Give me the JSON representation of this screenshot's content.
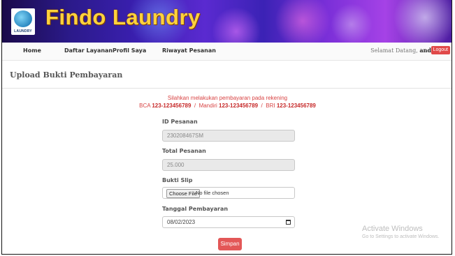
{
  "header": {
    "brand": "Findo Laundry",
    "logo_text": "LAUNDRY"
  },
  "nav": {
    "items": [
      "Home",
      "Daftar Layanan",
      "Profil Saya",
      "Riwayat Pesanan"
    ],
    "welcome_prefix": "Selamat Datang,",
    "username": "andi",
    "logout_label": "Logout"
  },
  "page": {
    "title": "Upload Bukti Pembayaran"
  },
  "instructions": {
    "line1": "Silahkan melakukan pembayaran pada rekening",
    "bca_label": "BCA",
    "bca_no": "123-123456789",
    "mandiri_label": "Mandiri",
    "mandiri_no": "123-123456789",
    "bri_label": "BRI",
    "bri_no": "123-123456789",
    "separator": "/"
  },
  "form": {
    "id_label": "ID Pesanan",
    "id_value": "230208467SM",
    "total_label": "Total Pesanan",
    "total_value": "25.000",
    "slip_label": "Bukti Slip",
    "file_button": "Choose File",
    "file_status": "No file chosen",
    "date_label": "Tanggal Pembayaran",
    "date_value": "08/02/2023",
    "submit_label": "Simpan"
  },
  "watermark": {
    "title": "Activate Windows",
    "subtitle": "Go to Settings to activate Windows."
  },
  "colors": {
    "accent_red": "#e35757",
    "brand_yellow": "#ffd23c",
    "banner_purple": "#3a1fb0"
  }
}
